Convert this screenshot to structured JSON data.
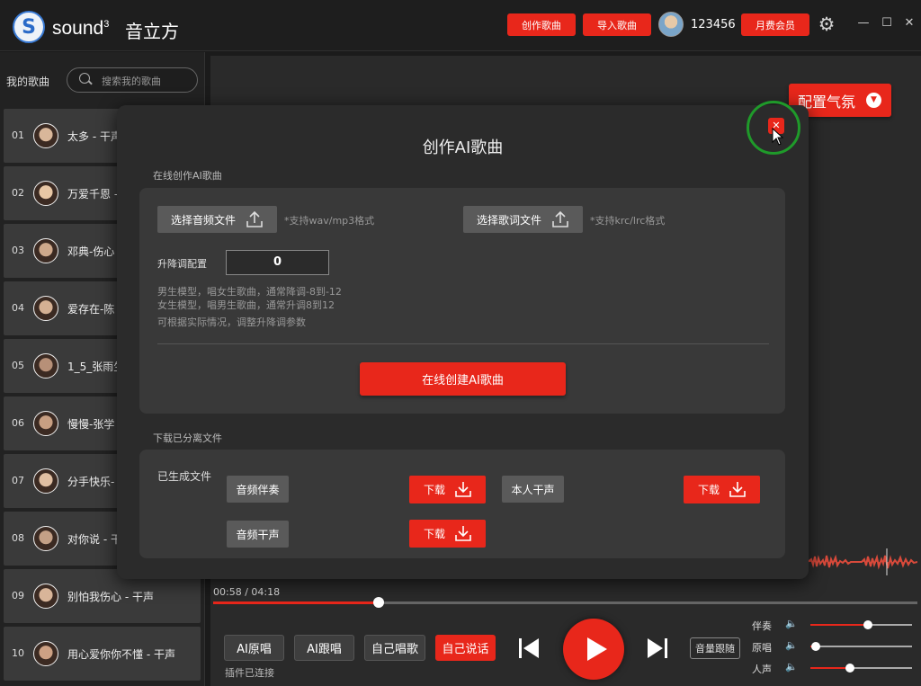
{
  "app": {
    "logo_letter": "S",
    "brand": "sound",
    "brand_sup": "3",
    "brand_cn": "音立方",
    "create_song": "创作歌曲",
    "import_song": "导入歌曲",
    "username": "123456",
    "vip": "月费会员"
  },
  "sidebar": {
    "title": "我的歌曲",
    "search_placeholder": "搜索我的歌曲",
    "songs": [
      {
        "num": "01",
        "name": "太多 - 干声"
      },
      {
        "num": "02",
        "name": "万爱千恩 -"
      },
      {
        "num": "03",
        "name": "邓典-伤心"
      },
      {
        "num": "04",
        "name": "爱存在-陈"
      },
      {
        "num": "05",
        "name": "1_5_张雨生"
      },
      {
        "num": "06",
        "name": "慢慢-张学"
      },
      {
        "num": "07",
        "name": "分手快乐-"
      },
      {
        "num": "08",
        "name": "对你说 - 干"
      },
      {
        "num": "09",
        "name": "别怕我伤心 - 干声"
      },
      {
        "num": "10",
        "name": "用心爱你你不懂 - 干声"
      }
    ]
  },
  "main": {
    "atmosphere": "配置气氛",
    "time": "00:58 / 04:18",
    "progress": 0.235,
    "modes": [
      "AI原唱",
      "AI跟唱",
      "自己唱歌",
      "自己说话"
    ],
    "plugin_status": "插件已连接",
    "volume_follow": "音量跟随",
    "mixer": [
      {
        "label": "伴奏",
        "value": 0.57
      },
      {
        "label": "原唱",
        "value": 0.05
      },
      {
        "label": "人声",
        "value": 0.39
      }
    ]
  },
  "modal": {
    "title": "创作AI歌曲",
    "section_online": "在线创作AI歌曲",
    "select_audio": "选择音频文件",
    "audio_hint": "*支持wav/mp3格式",
    "select_lyrics": "选择歌词文件",
    "lyrics_hint": "*支持krc/lrc格式",
    "pitch_label": "升降调配置",
    "pitch_value": "0",
    "note1": "男生模型，唱女生歌曲，通常降调-8到-12",
    "note2": "女生模型，唱男生歌曲，通常升调8到12",
    "note3": "可根据实际情况，调整升降调参数",
    "create_button": "在线创建AI歌曲",
    "section_download": "下载已分离文件",
    "generated_label": "已生成文件",
    "files": {
      "accompaniment": "音频伴奏",
      "own_dry": "本人干声",
      "audio_dry": "音频干声"
    },
    "download": "下载"
  },
  "colors": {
    "accent": "#e8271b",
    "highlight_ring": "#1f9a2a"
  }
}
